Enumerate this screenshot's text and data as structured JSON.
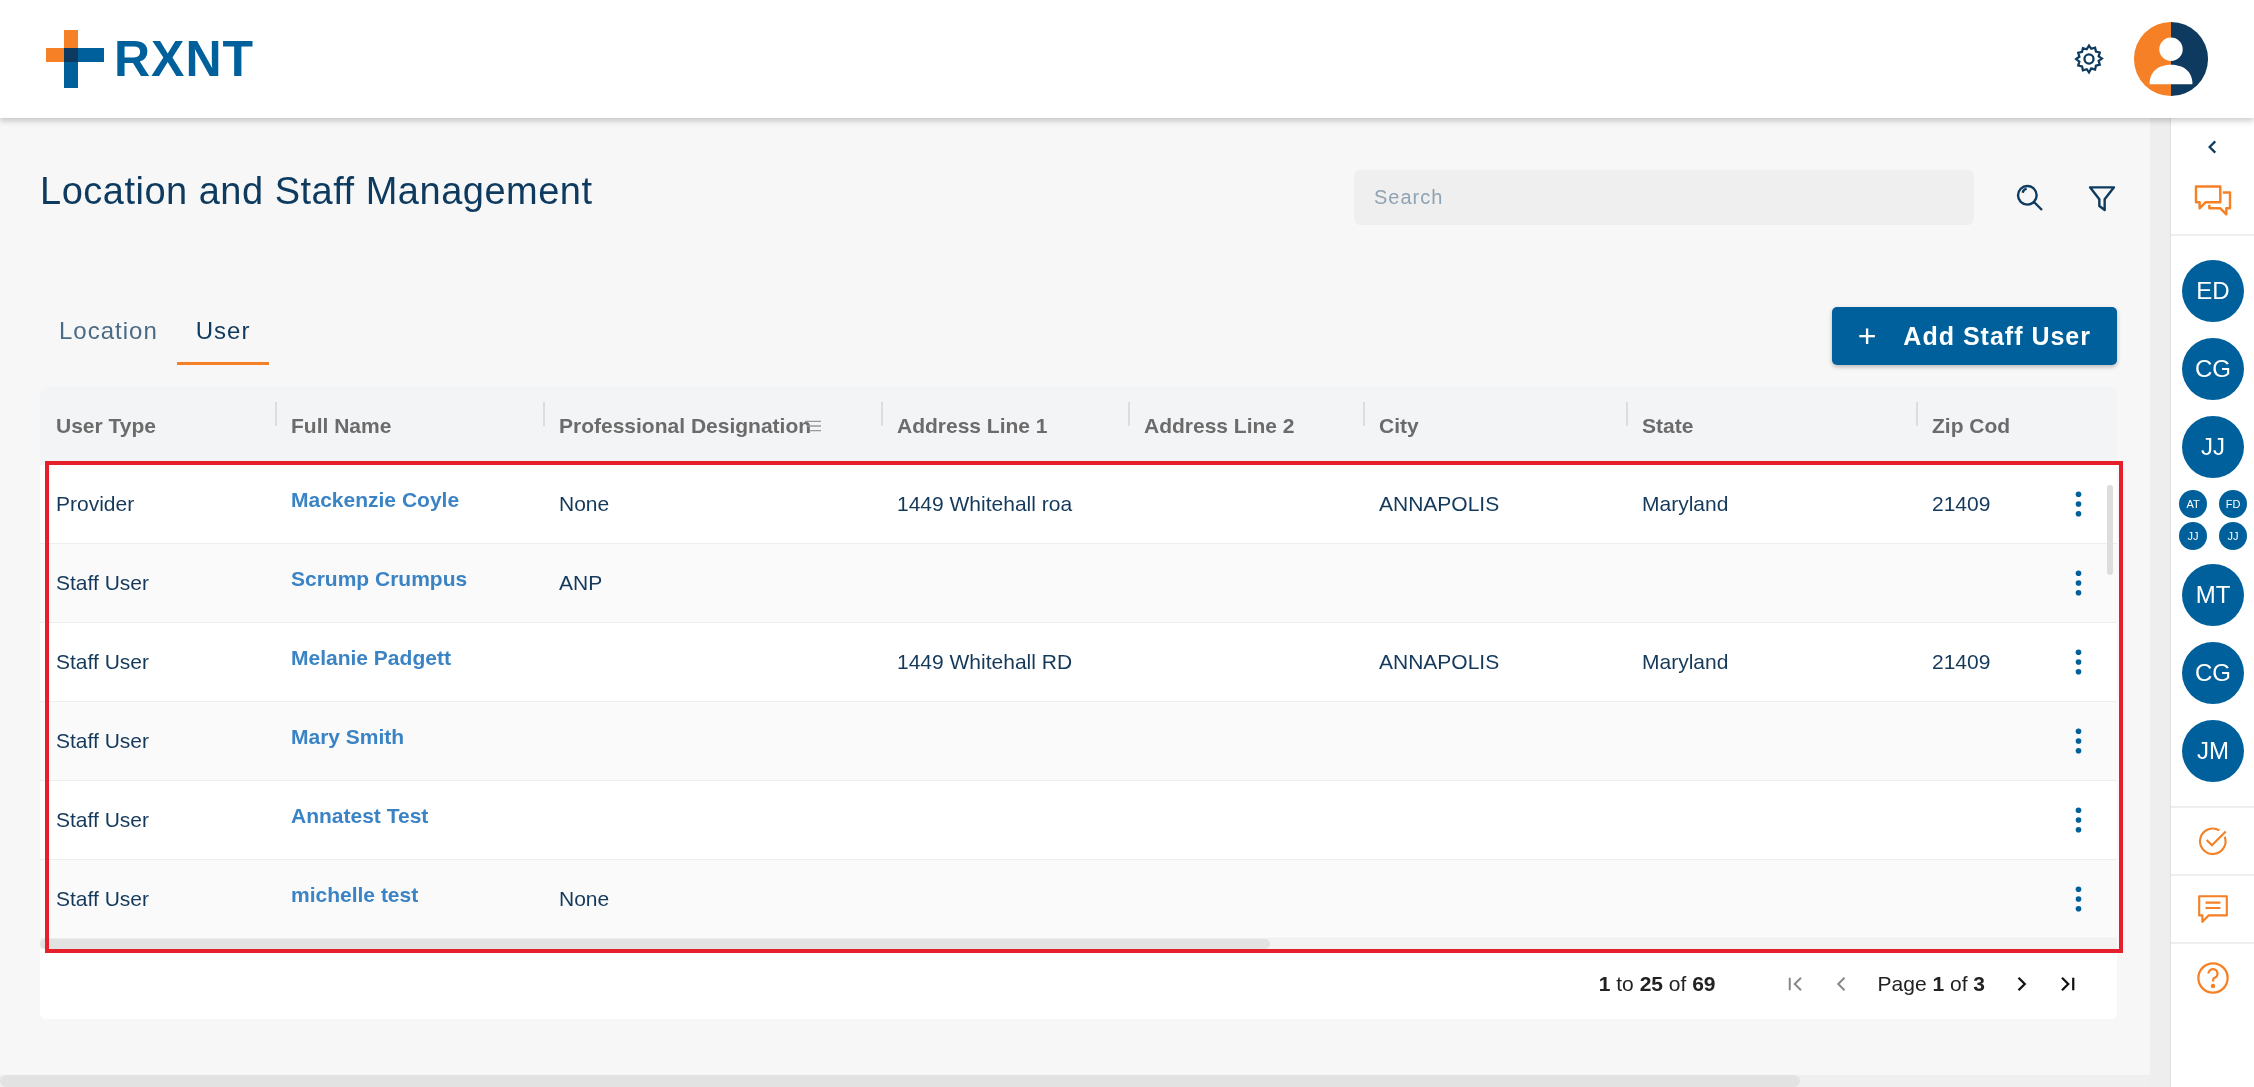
{
  "header": {
    "logo": "RXNT"
  },
  "page": {
    "title": "Location and Staff Management"
  },
  "search": {
    "placeholder": "Search"
  },
  "tabs": [
    {
      "label": "Location",
      "selected": false
    },
    {
      "label": "User",
      "selected": true
    }
  ],
  "add_button": {
    "icon": "+",
    "label": "Add Staff User"
  },
  "table": {
    "columns": [
      "User Type",
      "Full Name",
      "Professional Designation",
      "Address Line 1",
      "Address Line 2",
      "City",
      "State",
      "Zip Cod"
    ],
    "rows": [
      {
        "user_type": "Provider",
        "full_name": "Mackenzie Coyle",
        "professional_designation": "None",
        "address_line_1": "1449 Whitehall roa",
        "city": "ANNAPOLIS",
        "state": "Maryland",
        "zip_code": "21409"
      },
      {
        "user_type": "Staff User",
        "full_name": "Scrump Crumpus",
        "professional_designation": "ANP"
      },
      {
        "user_type": "Staff User",
        "full_name": "Melanie Padgett",
        "address_line_1": "1449 Whitehall RD",
        "city": "ANNAPOLIS",
        "state": "Maryland",
        "zip_code": "21409"
      },
      {
        "user_type": "Staff User",
        "full_name": "Mary Smith"
      },
      {
        "user_type": "Staff User",
        "full_name": "Annatest Test"
      },
      {
        "user_type": "Staff User",
        "full_name": "michelle test",
        "professional_designation": "None"
      }
    ]
  },
  "pagination": {
    "range": "**1** to **25** of **69**",
    "page": "Page **1** of **3**"
  },
  "sidebar": {
    "avatars_top": [
      "ED",
      "CG",
      "JJ"
    ],
    "mini_avatars": [
      "AT",
      "FD",
      "JJ",
      "JJ"
    ],
    "avatars_bottom": [
      "MT",
      "CG",
      "JM"
    ]
  }
}
